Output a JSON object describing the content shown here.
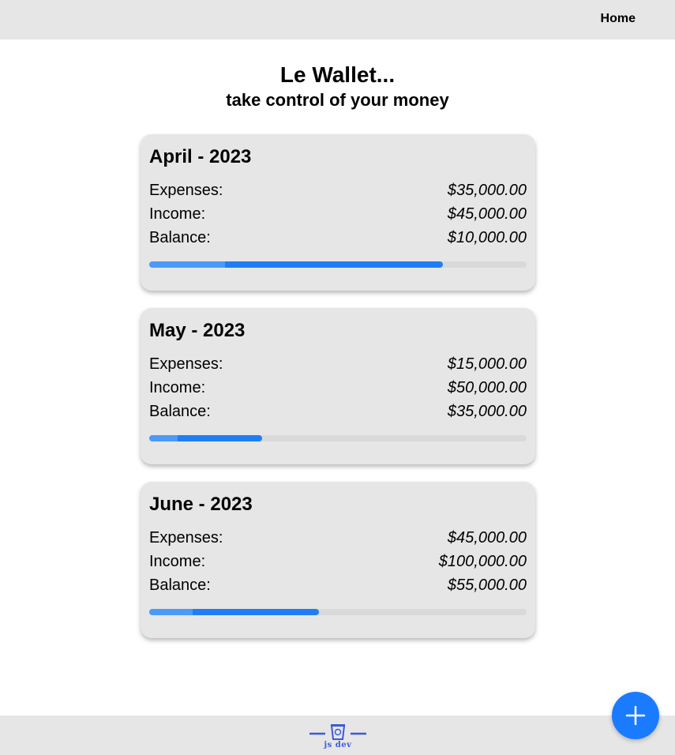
{
  "nav": {
    "home_label": "Home"
  },
  "hero": {
    "title": "Le Wallet...",
    "subtitle": "take control of your money"
  },
  "labels": {
    "expenses": "Expenses:",
    "income": "Income:",
    "balance": "Balance:"
  },
  "months": [
    {
      "title": "April - 2023",
      "expenses": "$35,000.00",
      "income": "$45,000.00",
      "balance": "$10,000.00",
      "expense_ratio": 0.778,
      "light_segment": 0.2
    },
    {
      "title": "May - 2023",
      "expenses": "$15,000.00",
      "income": "$50,000.00",
      "balance": "$35,000.00",
      "expense_ratio": 0.3,
      "light_segment": 0.076
    },
    {
      "title": "June - 2023",
      "expenses": "$45,000.00",
      "income": "$100,000.00",
      "balance": "$55,000.00",
      "expense_ratio": 0.45,
      "light_segment": 0.115
    }
  ],
  "footer": {
    "logo_text": "js dev"
  },
  "colors": {
    "accent": "#1a7bff",
    "bar_fill": "#1f7ef5",
    "bar_fill_light": "#4b9af7",
    "bar_track": "#d9d9d9",
    "panel": "#e6e6e6",
    "logo": "#3b5bd9"
  },
  "icons": {
    "fab": "plus-icon",
    "logo": "cup-icon"
  }
}
